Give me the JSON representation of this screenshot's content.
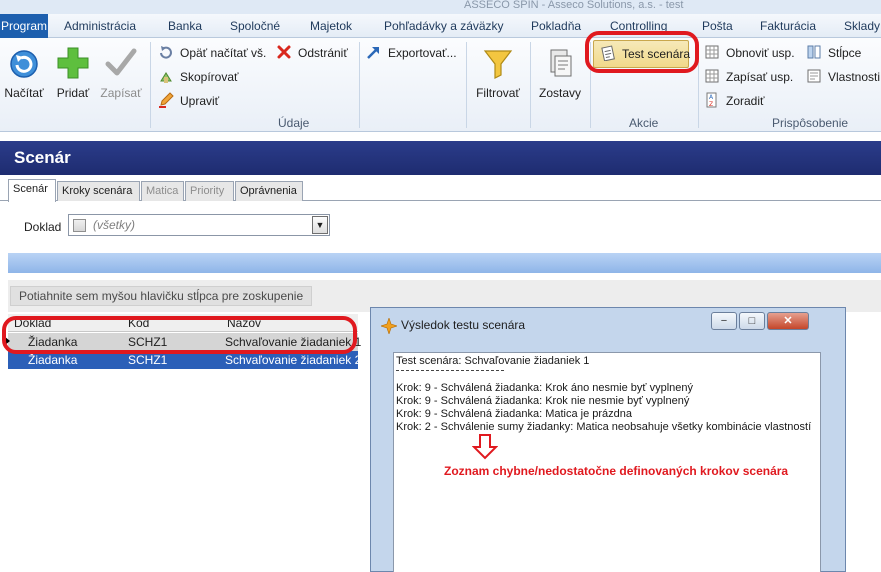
{
  "window": {
    "title": "ASSECO SPIN - Asseco Solutions, a.s. - test"
  },
  "menu": {
    "program": "Program",
    "tabs": [
      "Administrácia",
      "Banka",
      "Spoločné",
      "Majetok",
      "Pohľadávky a záväzky",
      "Pokladňa",
      "Controlling",
      "Pošta",
      "Fakturácia",
      "Sklady"
    ]
  },
  "ribbon": {
    "nacitat": "Načítať",
    "pridat": "Pridať",
    "zapisat": "Zapísať",
    "opat_nacitat": "Opäť načítať vš.",
    "odstranit": "Odstrániť",
    "skopirovat": "Skopírovať",
    "upravit": "Upraviť",
    "exportovat": "Exportovať...",
    "filtrovat": "Filtrovať",
    "zostavy": "Zostavy",
    "test_scenara": "Test scenára",
    "obnovit_usp": "Obnoviť usp.",
    "zapisat_usp": "Zapísať usp.",
    "zoradit": "Zoradiť",
    "stlpce": "Stĺpce",
    "vlastnosti": "Vlastnosti",
    "group_udaje": "Údaje",
    "group_akcie": "Akcie",
    "group_prisposobenie": "Prispôsobenie"
  },
  "page": {
    "title": "Scenár"
  },
  "tabs": [
    {
      "label": "Scenár",
      "state": "active"
    },
    {
      "label": "Kroky scenára",
      "state": "normal"
    },
    {
      "label": "Matica",
      "state": "disabled"
    },
    {
      "label": "Priority",
      "state": "disabled"
    },
    {
      "label": "Oprávnenia",
      "state": "normal"
    }
  ],
  "filter": {
    "label": "Doklad",
    "value": "(všetky)"
  },
  "grid": {
    "group_hint": "Potiahnite sem myšou hlavičku stĺpca pre zoskupenie",
    "columns": [
      "Doklad",
      "Kód",
      "Názov"
    ],
    "rows": [
      [
        "Žiadanka",
        "SCHZ1",
        "Schvaľovanie žiadaniek 1"
      ],
      [
        "Žiadanka",
        "SCHZ1",
        "Schvaľovanie žiadaniek 2"
      ]
    ]
  },
  "dialog": {
    "title": "Výsledok testu scenára",
    "minimize": "−",
    "maximize": "□",
    "close": "✕",
    "lines": [
      "Test scenára: Schvaľovanie žiadaniek 1",
      "Krok: 9 - Schválená žiadanka: Krok áno nesmie byť vyplnený",
      "Krok: 9 - Schválená žiadanka: Krok nie nesmie byť vyplnený",
      "Krok: 9 - Schválená žiadanka: Matica je prázdna",
      "Krok: 2 - Schválenie sumy žiadanky: Matica neobsahuje všetky kombinácie vlastností"
    ]
  },
  "annotation": "Zoznam chybne/nedostatočne definovaných krokov scenára",
  "colors": {
    "accent": "#1d5fae",
    "header": "#233480",
    "highlight": "#e0191f",
    "selected_row": "#2b5fb8"
  }
}
